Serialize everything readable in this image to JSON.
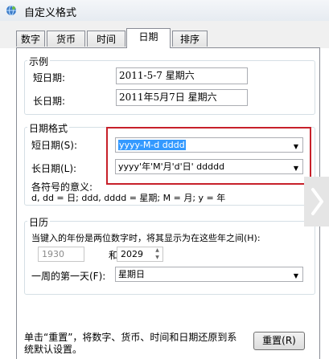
{
  "window": {
    "title": "自定义格式"
  },
  "tabs": [
    {
      "label": "数字"
    },
    {
      "label": "货币"
    },
    {
      "label": "时间"
    },
    {
      "label": "日期"
    },
    {
      "label": "排序"
    }
  ],
  "examples": {
    "group_title": "示例",
    "short_label": "短日期:",
    "short_value": "2011-5-7 星期六",
    "long_label": "长日期:",
    "long_value": "2011年5月7日 星期六"
  },
  "formats": {
    "group_title": "日期格式",
    "short_label": "短日期(S):",
    "short_value": "yyyy-M-d dddd",
    "long_label": "长日期(L):",
    "long_value": "yyyy'年'M'月'd'日' ddddd",
    "symbols_title": "各符号的意义:",
    "symbols_text": "d, dd = 日;  ddd, dddd = 星期;  M = 月;  y = 年"
  },
  "calendar": {
    "group_title": "日历",
    "two_digit_text": "当键入的年份是两位数字时，将其显示为在这些年之间(H):",
    "year_from": "1930",
    "and_label": "和",
    "year_to": "2029",
    "first_day_label": "一周的第一天(F):",
    "first_day_value": "星期日"
  },
  "footer": {
    "reset_text_line1": "单击“重置”，将数字、货币、时间和日期还原到系",
    "reset_text_line2": "统默认设置。",
    "reset_button": "重置(R)"
  },
  "colors": {
    "highlight": "#c7202a",
    "selection": "#3399ff"
  },
  "icons": {
    "app": "globe-icon",
    "dropdown": "chevron-down-icon",
    "next": "chevron-right-icon"
  }
}
